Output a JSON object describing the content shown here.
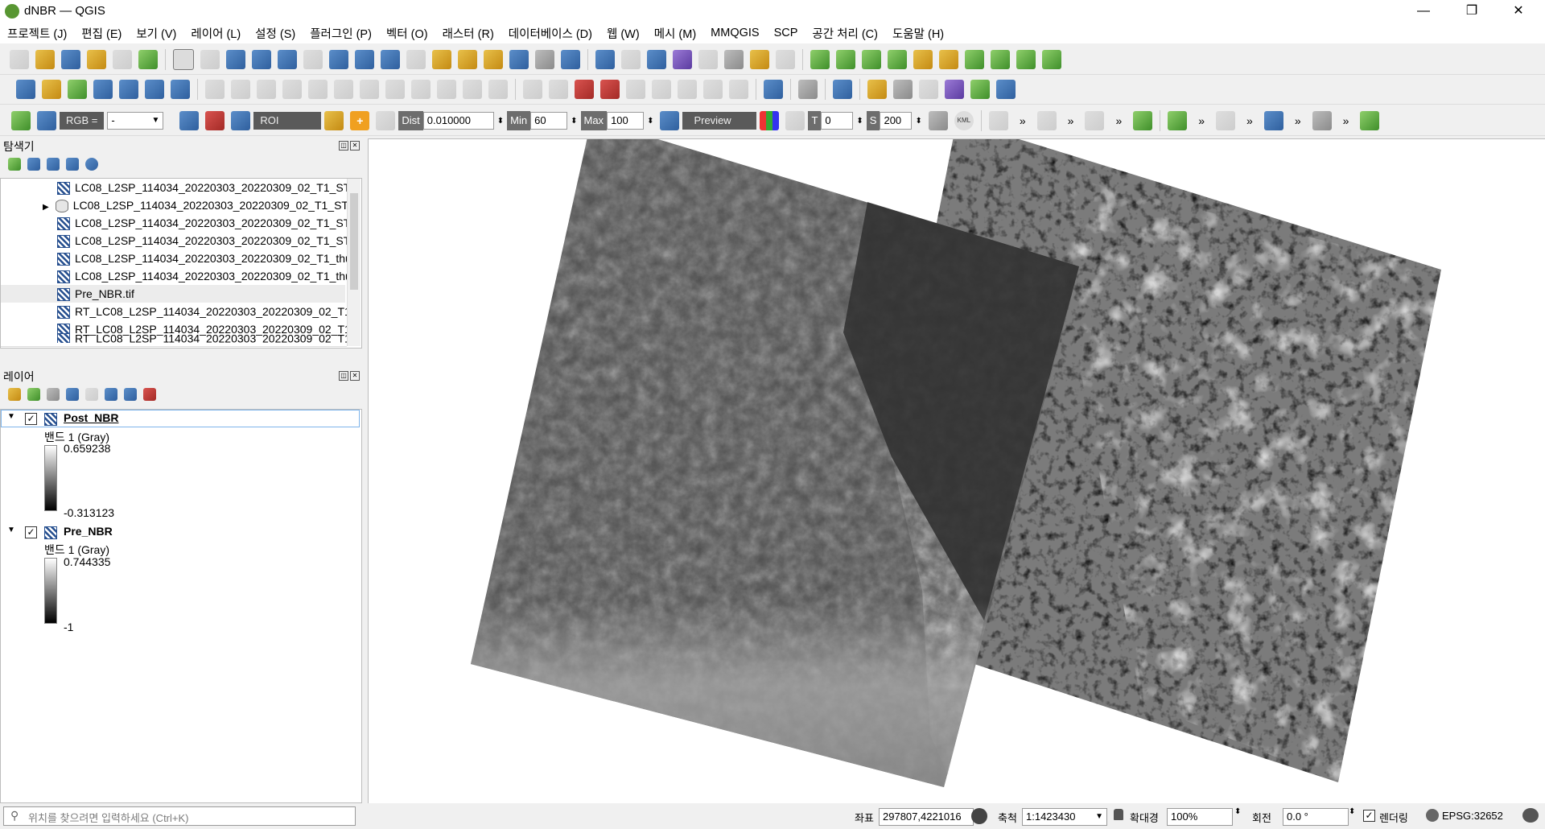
{
  "window": {
    "title": "dNBR — QGIS",
    "minimize": "—",
    "maximize": "❐",
    "close": "✕"
  },
  "menu": [
    "프로젝트 (J)",
    "편집 (E)",
    "보기 (V)",
    "레이어 (L)",
    "설정 (S)",
    "플러그인 (P)",
    "벡터 (O)",
    "래스터 (R)",
    "데이터베이스 (D)",
    "웹 (W)",
    "메시 (M)",
    "MMQGIS",
    "SCP",
    "공간 처리 (C)",
    "도움말 (H)"
  ],
  "scp_toolbar": {
    "rgb_label": "RGB =",
    "rgb_value": "-",
    "roi_label": "ROI",
    "dist_label": "Dist",
    "dist_value": "0.010000",
    "min_label": "Min",
    "min_value": "60",
    "max_label": "Max",
    "max_value": "100",
    "preview_label": "Preview",
    "t_label": "T",
    "t_value": "0",
    "s_label": "S",
    "s_value": "200",
    "kml_label": "KML",
    "overflow": "»"
  },
  "browser": {
    "title": "탐색기",
    "items": [
      {
        "label": "LC08_L2SP_114034_20220303_20220309_02_T1_ST_",
        "icon": "raster-icon"
      },
      {
        "label": "LC08_L2SP_114034_20220303_20220309_02_T1_ST_",
        "icon": "database-icon",
        "expandable": true
      },
      {
        "label": "LC08_L2SP_114034_20220303_20220309_02_T1_ST_",
        "icon": "raster-icon"
      },
      {
        "label": "LC08_L2SP_114034_20220303_20220309_02_T1_ST_",
        "icon": "raster-icon"
      },
      {
        "label": "LC08_L2SP_114034_20220303_20220309_02_T1_thu",
        "icon": "raster-icon"
      },
      {
        "label": "LC08_L2SP_114034_20220303_20220309_02_T1_thu",
        "icon": "raster-icon"
      },
      {
        "label": "Pre_NBR.tif",
        "icon": "raster-icon",
        "selected": true
      },
      {
        "label": "RT_LC08_L2SP_114034_20220303_20220309_02_T1_",
        "icon": "raster-icon"
      },
      {
        "label": "RT_LC08_L2SP_114034_20220303_20220309_02_T1_",
        "icon": "raster-icon"
      },
      {
        "label": "RT_LC08_L2SP_114034_20220303_20220309_02_T1_",
        "icon": "raster-icon"
      }
    ]
  },
  "layers": {
    "title": "레이어",
    "items": [
      {
        "name": "Post_NBR",
        "band": "밴드 1 (Gray)",
        "max": "0.659238",
        "min": "-0.313123",
        "checked": true
      },
      {
        "name": "Pre_NBR",
        "band": "밴드 1 (Gray)",
        "max": "0.744335",
        "min": "-1",
        "checked": true
      }
    ]
  },
  "status": {
    "search_placeholder": "위치를 찾으려면 입력하세요 (Ctrl+K)",
    "coord_label": "좌표",
    "coord_value": "297807,4221016",
    "scale_label": "축척",
    "scale_value": "1:1423430",
    "magnifier_label": "확대경",
    "magnifier_value": "100%",
    "rotation_label": "회전",
    "rotation_value": "0.0 °",
    "render_label": "렌더링",
    "render_checked": true,
    "crs": "EPSG:32652"
  },
  "colors": {
    "qgis_green": "#589632",
    "selection_border": "#7eb4ea"
  }
}
